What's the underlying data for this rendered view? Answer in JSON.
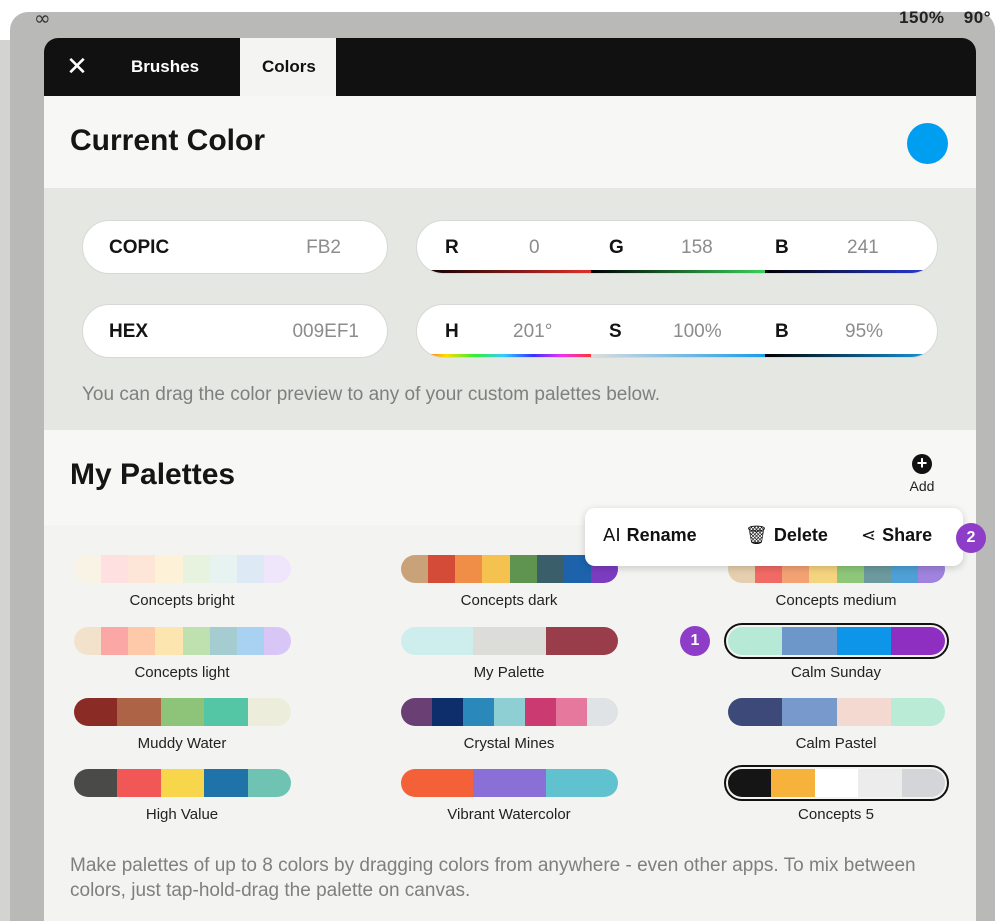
{
  "status": {
    "zoom": "150%",
    "rotation": "90°",
    "app_icon": "link-icon"
  },
  "tabs": {
    "close_icon": "✕",
    "brushes": "Brushes",
    "colors": "Colors"
  },
  "current_color": {
    "title": "Current Color",
    "swatch_color": "#009EF1"
  },
  "values": {
    "copic_label": "COPIC",
    "copic_value": "FB2",
    "hex_label": "HEX",
    "hex_value": "009EF1",
    "r_label": "R",
    "r_value": "0",
    "g_label": "G",
    "g_value": "158",
    "b_label": "B",
    "b_value": "241",
    "h_label": "H",
    "h_value": "201°",
    "s_label": "S",
    "s_value": "100%",
    "bri_label": "B",
    "bri_value": "95%",
    "hint": "You can drag the color preview to any of your custom palettes below."
  },
  "palettes_section": {
    "title": "My Palettes",
    "add_label": "Add"
  },
  "context_menu": {
    "rename": "Rename",
    "delete": "Delete",
    "share": "Share"
  },
  "badges": {
    "one": "1",
    "two": "2"
  },
  "palettes": [
    {
      "name": "Concepts bright",
      "selected": false,
      "colors": [
        "#f8f3e4",
        "#fde0df",
        "#fde6d8",
        "#fdf2d8",
        "#e7f3de",
        "#e7f3f0",
        "#ddeaf6",
        "#efe6fb"
      ]
    },
    {
      "name": "Concepts dark",
      "selected": false,
      "colors": [
        "#c9a27a",
        "#d44b37",
        "#f08d46",
        "#f6c24f",
        "#5e9450",
        "#3a5f6a",
        "#1d63ac",
        "#7c3cc0"
      ]
    },
    {
      "name": "Concepts medium",
      "selected": false,
      "colors": [
        "#e5cfae",
        "#f16a66",
        "#f3a373",
        "#f5d47f",
        "#8ec779",
        "#6c9a9e",
        "#4fa0d6",
        "#9f83df"
      ]
    },
    {
      "name": "Concepts light",
      "selected": false,
      "colors": [
        "#f3e2cb",
        "#fba7a5",
        "#fdc9a8",
        "#fde5b0",
        "#bfe1b0",
        "#a5ccd0",
        "#a9d1f1",
        "#d8c6f7"
      ]
    },
    {
      "name": "My Palette",
      "selected": false,
      "colors": [
        "#cdeeed",
        "#dcdcd8",
        "#9a3d4b"
      ]
    },
    {
      "name": "Calm Sunday",
      "selected": true,
      "colors": [
        "#b6ead7",
        "#6e97c9",
        "#0d95ea",
        "#8e2fc1"
      ]
    },
    {
      "name": "Muddy Water",
      "selected": false,
      "colors": [
        "#8a2b25",
        "#ad6446",
        "#8dc47a",
        "#55c6a5",
        "#eceedb"
      ]
    },
    {
      "name": "Crystal Mines",
      "selected": false,
      "colors": [
        "#6a3f73",
        "#0d2d6b",
        "#2b88ba",
        "#8ecfd3",
        "#cc3a72",
        "#e5789c",
        "#dfe3e6"
      ]
    },
    {
      "name": "Calm Pastel",
      "selected": false,
      "colors": [
        "#3d4a79",
        "#7799cc",
        "#f3d9cf",
        "#b9ebd6"
      ]
    },
    {
      "name": "High Value",
      "selected": false,
      "colors": [
        "#4a4a49",
        "#f15757",
        "#f8d64b",
        "#1f73a9",
        "#6ec3b2"
      ]
    },
    {
      "name": "Vibrant Watercolor",
      "selected": false,
      "colors": [
        "#f46037",
        "#8a6fd6",
        "#60c2cf"
      ]
    },
    {
      "name": "Concepts 5",
      "selected": true,
      "colors": [
        "#151515",
        "#f6b23a",
        "#ffffff",
        "#ececec",
        "#d3d5d8"
      ]
    }
  ],
  "footer": "Make palettes of up to 8 colors by dragging colors from anywhere - even other apps. To mix between colors, just tap-hold-drag the palette on canvas."
}
